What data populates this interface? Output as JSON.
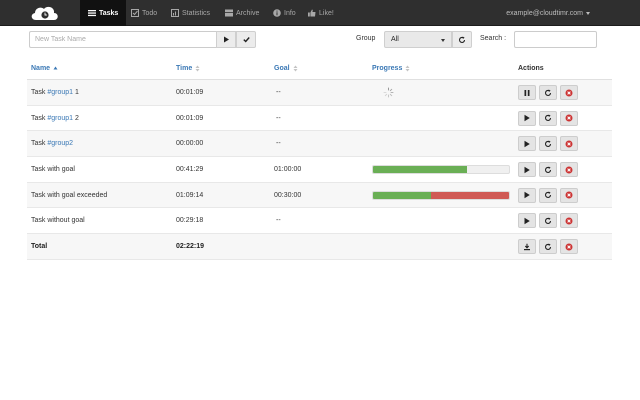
{
  "nav": {
    "items": [
      {
        "label": "Tasks",
        "icon": "list-icon"
      },
      {
        "label": "Todo",
        "icon": "checkbox-icon"
      },
      {
        "label": "Statistics",
        "icon": "chart-icon"
      },
      {
        "label": "Archive",
        "icon": "archive-icon"
      },
      {
        "label": "Info",
        "icon": "info-icon"
      },
      {
        "label": "Like!",
        "icon": "thumbs-up-icon"
      }
    ],
    "user": "example@cloudtimr.com"
  },
  "toolbar": {
    "new_task_placeholder": "New Task Name",
    "group_label": "Group",
    "group_value": "All",
    "search_label": "Search :"
  },
  "table": {
    "headers": {
      "name": "Name",
      "time": "Time",
      "goal": "Goal",
      "progress": "Progress",
      "actions": "Actions"
    },
    "rows": [
      {
        "name_prefix": "Task ",
        "tag": "#group1",
        "name_suffix": " 1",
        "time": "00:01:09",
        "goal": "--",
        "state": "running"
      },
      {
        "name_prefix": "Task ",
        "tag": "#group1",
        "name_suffix": " 2",
        "time": "00:01:09",
        "goal": "--",
        "state": "stopped"
      },
      {
        "name_prefix": "Task ",
        "tag": "#group2",
        "name_suffix": "",
        "time": "00:00:00",
        "goal": "--",
        "state": "stopped"
      },
      {
        "name_prefix": "Task with goal",
        "tag": "",
        "name_suffix": "",
        "time": "00:41:29",
        "goal": "01:00:00",
        "state": "stopped",
        "progress_pct": 69
      },
      {
        "name_prefix": "Task with goal exceeded",
        "tag": "",
        "name_suffix": "",
        "time": "01:09:14",
        "goal": "00:30:00",
        "state": "stopped",
        "progress_pct": 100,
        "exceeded_pct": 57
      },
      {
        "name_prefix": "Task without goal",
        "tag": "",
        "name_suffix": "",
        "time": "00:29:18",
        "goal": "--",
        "state": "stopped"
      }
    ],
    "total": {
      "label": "Total",
      "time": "02:22:19"
    }
  },
  "colors": {
    "progress_ok": "#6aaf55",
    "progress_over": "#d05a55",
    "link": "#3a78b5",
    "navbar": "#2f2f2f"
  }
}
